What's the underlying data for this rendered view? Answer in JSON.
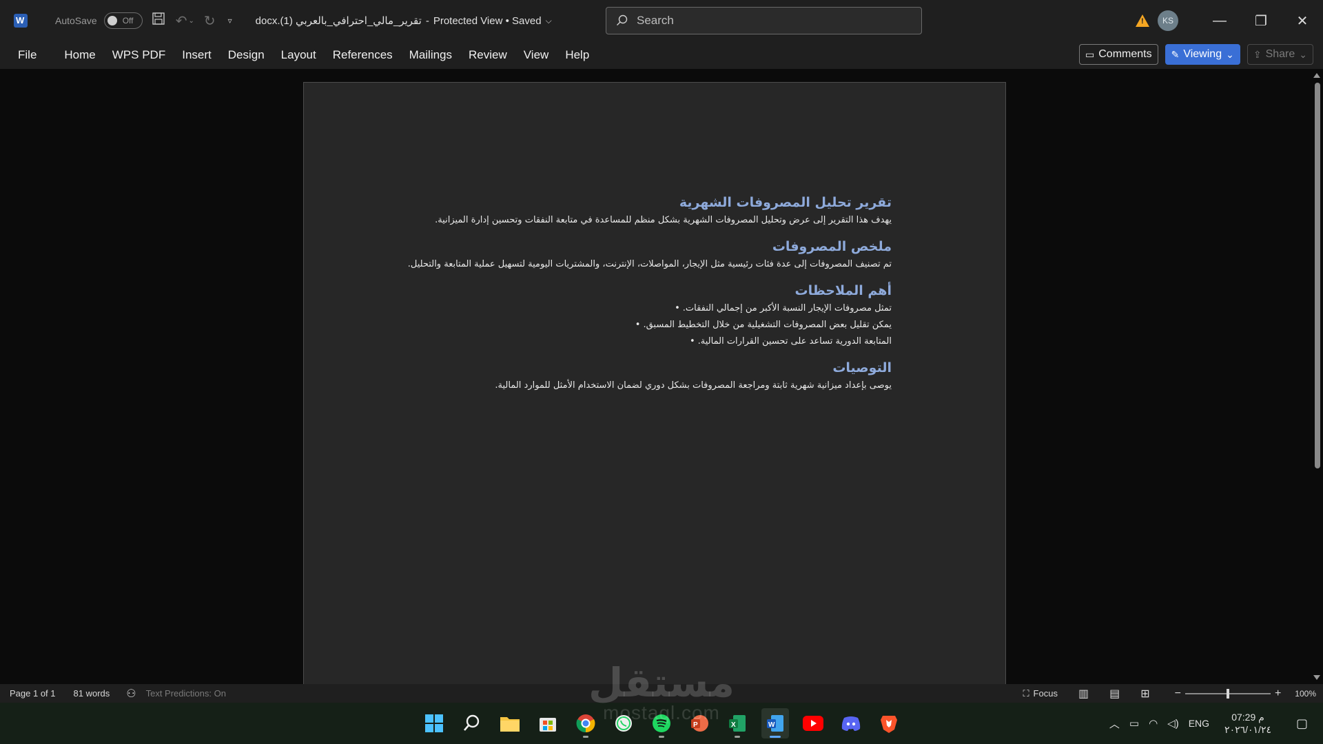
{
  "titlebar": {
    "autosave_label": "AutoSave",
    "autosave_state": "Off",
    "document_title": "تقرير_مالي_احترافي_بالعربي (1).docx",
    "view_state": "Protected View • Saved",
    "search_placeholder": "Search",
    "user_initials": "KS"
  },
  "ribbon": {
    "tabs": [
      "File",
      "Home",
      "WPS PDF",
      "Insert",
      "Design",
      "Layout",
      "References",
      "Mailings",
      "Review",
      "View",
      "Help"
    ],
    "comments_label": "Comments",
    "viewing_label": "Viewing",
    "share_label": "Share"
  },
  "document": {
    "title": "تقرير تحليل المصروفات الشهرية",
    "intro": "يهدف هذا التقرير إلى عرض وتحليل المصروفات الشهرية بشكل منظم للمساعدة في متابعة النفقات وتحسين إدارة الميزانية.",
    "summary_heading": "ملخص المصروفات",
    "summary_text": "تم تصنيف المصروفات إلى عدة فئات رئيسية مثل الإيجار، المواصلات، الإنترنت، والمشتريات اليومية لتسهيل عملية المتابعة والتحليل.",
    "notes_heading": "أهم الملاحظات",
    "notes": [
      "تمثل مصروفات الإيجار النسبة الأكبر من إجمالي النفقات.",
      "يمكن تقليل بعض المصروفات التشغيلية من خلال التخطيط المسبق.",
      "المتابعة الدورية تساعد على تحسين القرارات المالية."
    ],
    "recommendations_heading": "التوصيات",
    "recommendations_text": "يوصى بإعداد ميزانية شهرية ثابتة ومراجعة المصروفات بشكل دوري لضمان الاستخدام الأمثل للموارد المالية."
  },
  "statusbar": {
    "page": "Page 1 of 1",
    "words": "81 words",
    "text_predictions": "Text Predictions: On",
    "focus": "Focus",
    "zoom": "100%"
  },
  "taskbar": {
    "apps": [
      "windows-start",
      "search",
      "file-explorer",
      "microsoft-store",
      "chrome",
      "whatsapp",
      "spotify",
      "powerpoint",
      "excel",
      "word",
      "youtube",
      "discord",
      "brave"
    ],
    "language": "ENG",
    "time": "07:29 م",
    "date": "٢٠٢٦/٠١/٢٤"
  },
  "watermark": {
    "main": "مستقل",
    "sub": "mostaql.com"
  }
}
